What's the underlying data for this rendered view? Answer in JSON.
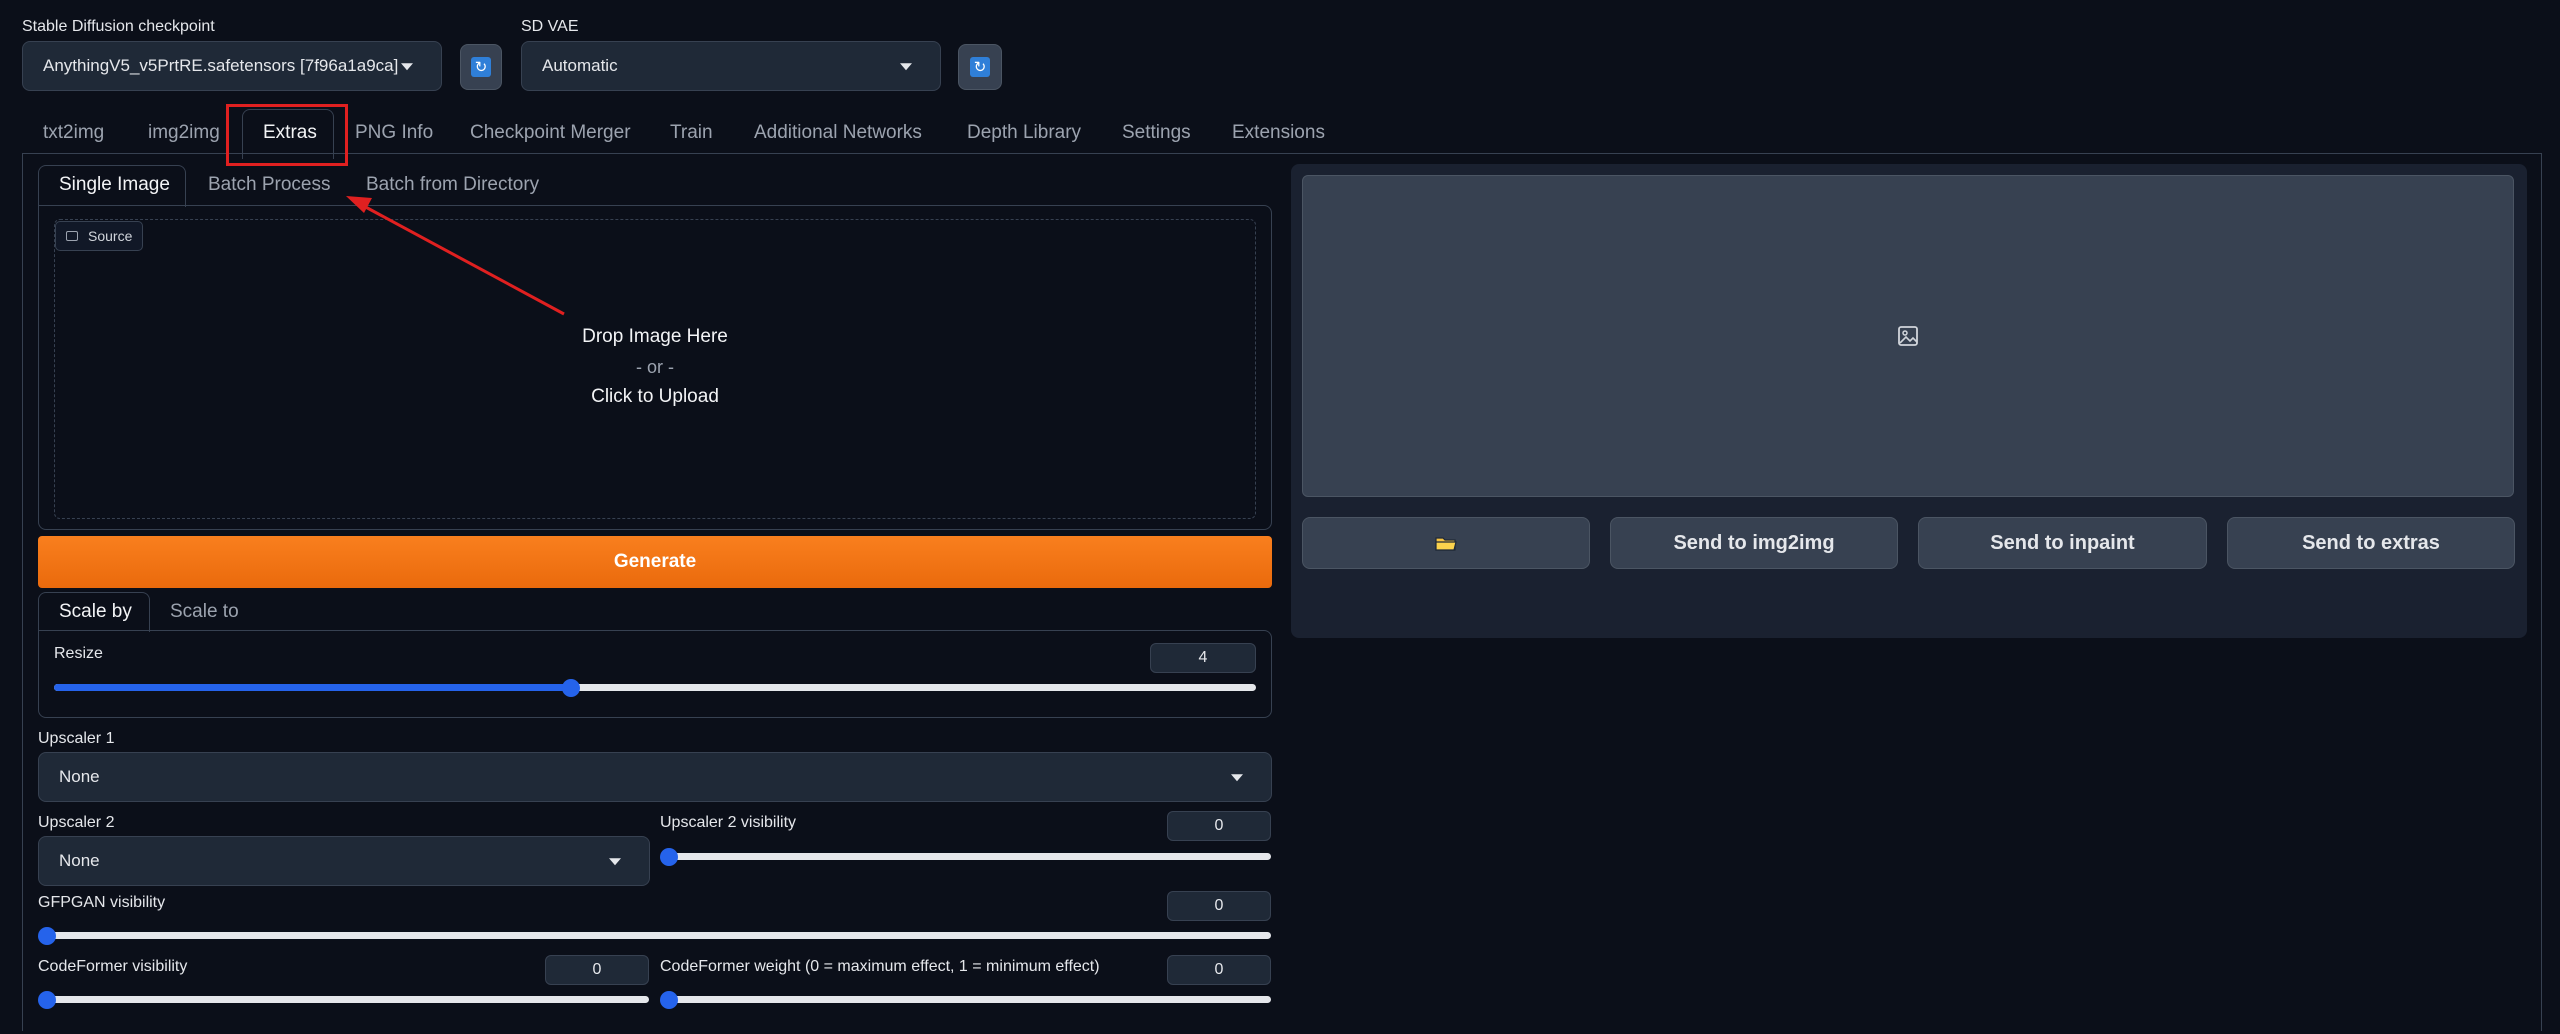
{
  "checkpoint": {
    "label": "Stable Diffusion checkpoint",
    "value": "AnythingV5_v5PrtRE.safetensors [7f96a1a9ca]"
  },
  "vae": {
    "label": "SD VAE",
    "value": "Automatic"
  },
  "tabs": [
    "txt2img",
    "img2img",
    "Extras",
    "PNG Info",
    "Checkpoint Merger",
    "Train",
    "Additional Networks",
    "Depth Library",
    "Settings",
    "Extensions"
  ],
  "subtabs": [
    "Single Image",
    "Batch Process",
    "Batch from Directory"
  ],
  "source": {
    "badge": "Source",
    "drop_text": "Drop Image Here",
    "or_text": "- or -",
    "click_text": "Click to Upload"
  },
  "generate_label": "Generate",
  "scale_tabs": [
    "Scale by",
    "Scale to"
  ],
  "resize": {
    "label": "Resize",
    "value": "4",
    "fraction": 0.43
  },
  "upscaler1": {
    "label": "Upscaler 1",
    "value": "None"
  },
  "upscaler2": {
    "label": "Upscaler 2",
    "value": "None"
  },
  "upscaler2_visibility": {
    "label": "Upscaler 2 visibility",
    "value": "0"
  },
  "gfpgan": {
    "label": "GFPGAN visibility",
    "value": "0"
  },
  "codeformer_vis": {
    "label": "CodeFormer visibility",
    "value": "0"
  },
  "codeformer_weight": {
    "label": "CodeFormer weight (0 = maximum effect, 1 = minimum effect)",
    "value": "0"
  },
  "output_buttons": {
    "folder_icon": "folder-icon",
    "send_img2img": "Send to img2img",
    "send_inpaint": "Send to inpaint",
    "send_extras": "Send to extras"
  },
  "colors": {
    "accent": "#f97316",
    "slider": "#2563eb",
    "annotation": "#e02020"
  }
}
